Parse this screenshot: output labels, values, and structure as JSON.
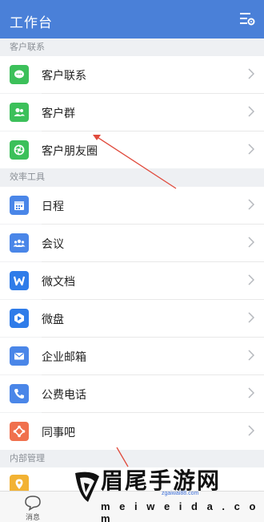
{
  "header": {
    "title": "工作台",
    "settings_icon": "settings-list-icon"
  },
  "sections": [
    {
      "label": "客户联系",
      "items": [
        {
          "label": "客户联系",
          "icon": "chat-bubble-icon",
          "color": "#3cc05a"
        },
        {
          "label": "客户群",
          "icon": "group-people-icon",
          "color": "#3cc05a"
        },
        {
          "label": "客户朋友圈",
          "icon": "aperture-icon",
          "color": "#3cc05a"
        }
      ]
    },
    {
      "label": "效率工具",
      "items": [
        {
          "label": "日程",
          "icon": "calendar-icon",
          "color": "#4a86e8"
        },
        {
          "label": "会议",
          "icon": "meeting-people-icon",
          "color": "#4a86e8"
        },
        {
          "label": "微文档",
          "icon": "w-document-icon",
          "color": "#2f7ce9"
        },
        {
          "label": "微盘",
          "icon": "drive-icon",
          "color": "#2f7ce9"
        },
        {
          "label": "企业邮箱",
          "icon": "mail-icon",
          "color": "#4a86e8"
        },
        {
          "label": "公费电话",
          "icon": "phone-icon",
          "color": "#4a86e8"
        },
        {
          "label": "同事吧",
          "icon": "share-nodes-icon",
          "color": "#f0704d"
        }
      ]
    },
    {
      "label": "内部管理",
      "items": [
        {
          "label": "",
          "icon": "location-pin-icon",
          "color": "#f2b233"
        }
      ]
    }
  ],
  "tabbar": {
    "messages_label": "消息"
  },
  "watermark": {
    "title": "眉尾手游网",
    "subtitle": "m e i w e i d a . c o m",
    "url": "zgaiwai88.com"
  },
  "colors": {
    "header": "#4a80d8",
    "accent_green": "#3cc05a",
    "accent_blue": "#4a86e8",
    "arrow": "#e04a3c"
  }
}
